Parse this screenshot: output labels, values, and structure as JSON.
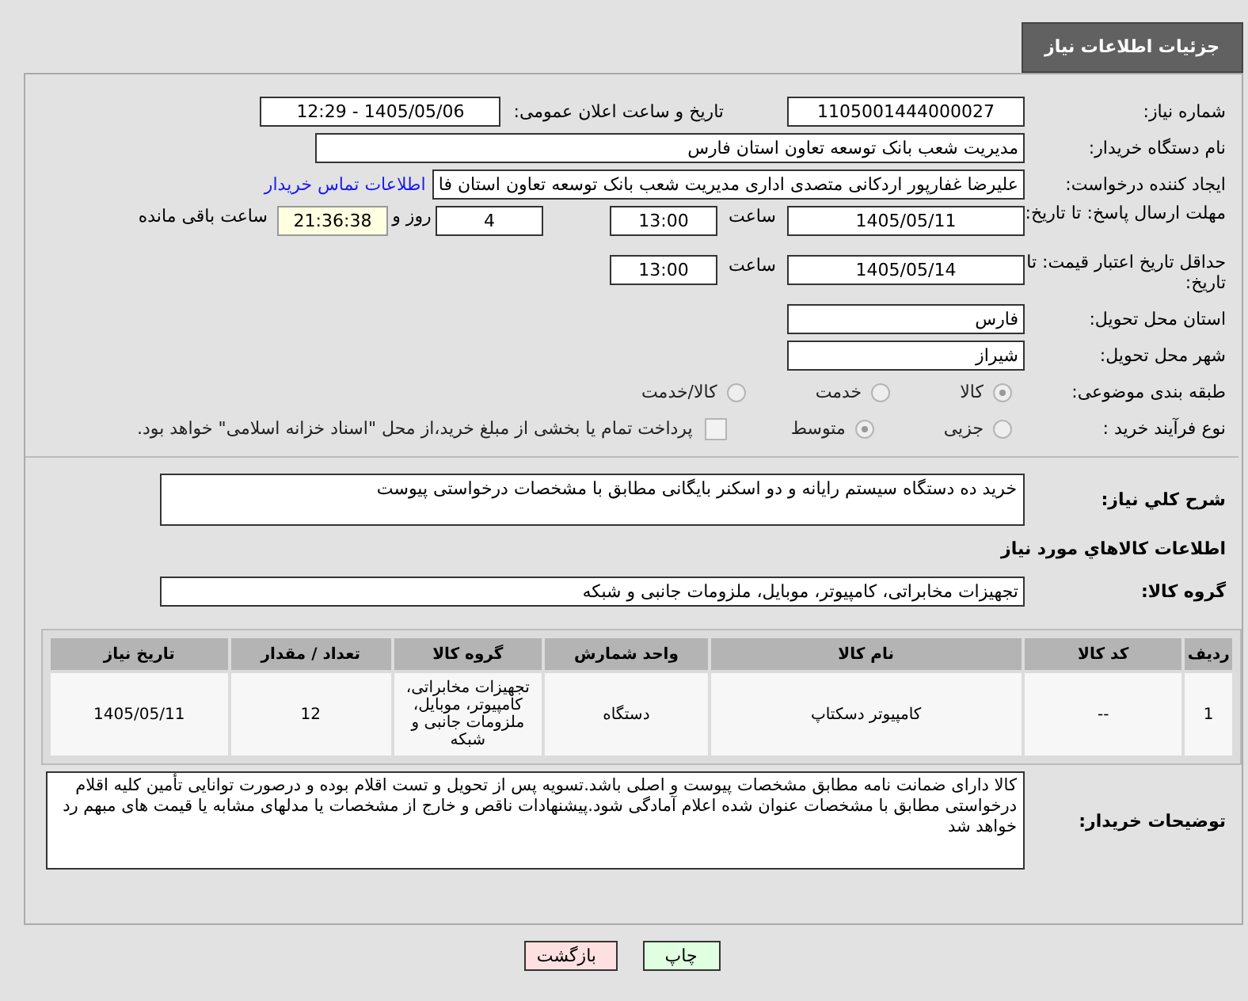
{
  "header_tab": {
    "title": "جزئیات اطلاعات نیاز"
  },
  "need_number": {
    "label": "شماره نیاز:",
    "value": "1105001444000027"
  },
  "announce_datetime": {
    "label": "تاریخ و ساعت اعلان عمومی:",
    "value": "1405/05/06 - 12:29"
  },
  "buyer_org": {
    "label": "نام دستگاه خریدار:",
    "value": "مدیریت شعب بانک توسعه تعاون استان فارس"
  },
  "requester": {
    "label": "ایجاد کننده درخواست:",
    "value": "علیرضا غفارپور اردکانی متصدی اداری مدیریت شعب بانک توسعه تعاون استان فا",
    "link": "اطلاعات تماس خریدار"
  },
  "response_deadline": {
    "label": "مهلت ارسال پاسخ: تا تاریخ:",
    "date": "1405/05/11",
    "time_label": "ساعت",
    "time": "13:00",
    "days": "4",
    "days_label": "روز و",
    "remaining": "21:36:38",
    "remaining_label": "ساعت باقی مانده"
  },
  "price_validity": {
    "label": "حداقل تاریخ اعتبار قیمت: تا تاریخ:",
    "date": "1405/05/14",
    "time_label": "ساعت",
    "time": "13:00"
  },
  "delivery_province": {
    "label": "استان محل تحویل:",
    "value": "فارس"
  },
  "delivery_city": {
    "label": "شهر محل تحویل:",
    "value": "شیراز"
  },
  "category": {
    "label": "طبقه بندی موضوعی:",
    "options": [
      {
        "label": "کالا",
        "selected": true
      },
      {
        "label": "خدمت",
        "selected": false
      },
      {
        "label": "کالا/خدمت",
        "selected": false
      }
    ]
  },
  "purchase_process": {
    "label": "نوع فرآیند خرید :",
    "options": [
      {
        "label": "جزیی",
        "selected": false
      },
      {
        "label": "متوسط",
        "selected": true
      }
    ],
    "payment_note": {
      "checked": false,
      "label": "پرداخت تمام یا بخشی از مبلغ خرید،از محل \"اسناد خزانه اسلامی\" خواهد بود."
    }
  },
  "description": {
    "label": "شرح کلي نياز:",
    "value": "خرید ده دستگاه سیستم رایانه و دو اسکنر بایگانی مطابق با مشخصات درخواستی پیوست"
  },
  "goods_section_title": "اطلاعات کالاهاي مورد نياز",
  "goods_group": {
    "label": "گروه کالا:",
    "value": "تجهیزات مخابراتی، کامپیوتر، موبایل، ملزومات جانبی و شبکه"
  },
  "table": {
    "columns": [
      "ردیف",
      "کد کالا",
      "نام کالا",
      "واحد شمارش",
      "گروه کالا",
      "تعداد / مقدار",
      "تاریخ نیاز"
    ],
    "rows": [
      [
        "1",
        "--",
        "کامپیوتر دسکتاپ",
        "دستگاه",
        "تجهیزات مخابراتی، کامپیوتر، موبایل، ملزومات جانبی و شبکه",
        "12",
        "1405/05/11"
      ]
    ]
  },
  "buyer_notes": {
    "label": "توضیحات خریدار:",
    "value": "کالا دارای ضمانت نامه مطابق مشخصات پیوست و اصلی باشد.تسویه پس از تحویل و تست اقلام بوده و درصورت توانایی تأمین کلیه اقلام درخواستی مطابق با مشخصات عنوان شده اعلام آمادگی شود.پیشنهادات ناقص و خارج از مشخصات یا مدلهای مشابه یا قیمت های مبهم رد خواهد شد"
  },
  "buttons": [
    {
      "label": "چاپ",
      "kind": "print"
    },
    {
      "label": "بازگشت",
      "kind": "back"
    }
  ]
}
